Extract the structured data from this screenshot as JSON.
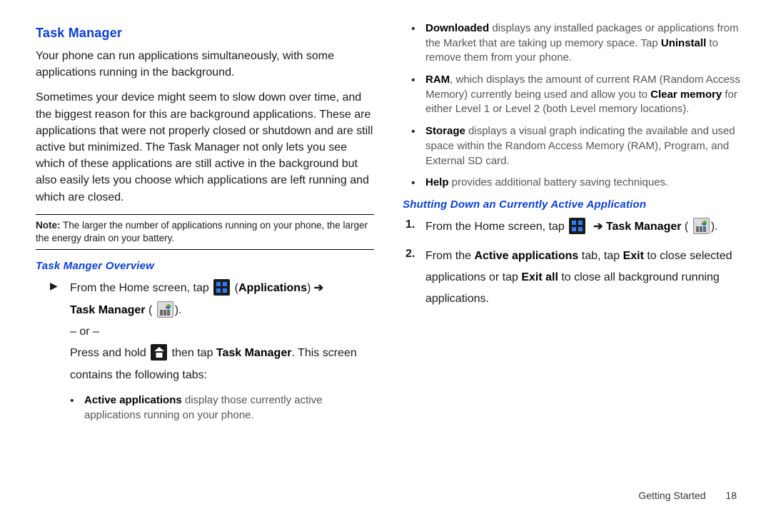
{
  "left": {
    "heading": "Task Manager",
    "p1": "Your phone can run applications simultaneously, with some applications running in the background.",
    "p2": "Sometimes your device might seem to slow down over time, and the biggest reason for this are background applications. These are applications that were not properly closed or shutdown and are still active but minimized. The Task Manager not only lets you see which of these applications are still active in the background but also easily lets you choose which applications are left running and which are closed.",
    "note_label": "Note:",
    "note_text": "The larger the number of applications running on your phone, the larger the energy drain on your battery.",
    "sub1": "Task Manger Overview",
    "step_intro_a": "From the Home screen, tap ",
    "step_intro_b": " (",
    "step_intro_apps": "Applications",
    "step_intro_c": ") ",
    "arrow": "➔",
    "step_tm_label": "Task Manager",
    "step_tm_tail": " (",
    "step_tm_close": ").",
    "or_line": "– or –",
    "press_a": "Press and hold ",
    "press_b": " then tap ",
    "press_tm": "Task Manager",
    "press_c": ". This screen contains the following tabs:",
    "bullet1_b": "Active applications",
    "bullet1_t": " display those currently active applications running on your phone."
  },
  "right": {
    "b_dl_b": "Downloaded",
    "b_dl_t1": " displays any installed packages or applications from the Market that are taking up memory space. Tap ",
    "b_dl_uninstall": "Uninstall",
    "b_dl_t2": " to remove them from your phone.",
    "b_ram_b": "RAM",
    "b_ram_t1": ", which displays the amount of current RAM (Random Access Memory) currently being used and allow you to ",
    "b_ram_clear": "Clear memory",
    "b_ram_t2": " for either Level 1 or Level 2 (both Level memory locations).",
    "b_st_b": "Storage",
    "b_st_t": " displays a visual graph indicating the available and used space within the Random Access Memory (RAM), Program, and External SD card.",
    "b_help_b": "Help",
    "b_help_t": " provides additional battery saving techniques.",
    "sub2": "Shutting Down an Currently Active Application",
    "s1_a": "From the Home screen, tap ",
    "s1_arrow": "➔",
    "s1_tm": "Task Manager",
    "s1_tail1": " (",
    "s1_tail2": ").",
    "s2_a": "From the ",
    "s2_tab": "Active applications",
    "s2_b": " tab, tap ",
    "s2_exit": "Exit",
    "s2_c": " to close selected applications or tap ",
    "s2_exitall": "Exit all",
    "s2_d": " to close all background running applications."
  },
  "footer": {
    "section": "Getting Started",
    "page": "18"
  }
}
